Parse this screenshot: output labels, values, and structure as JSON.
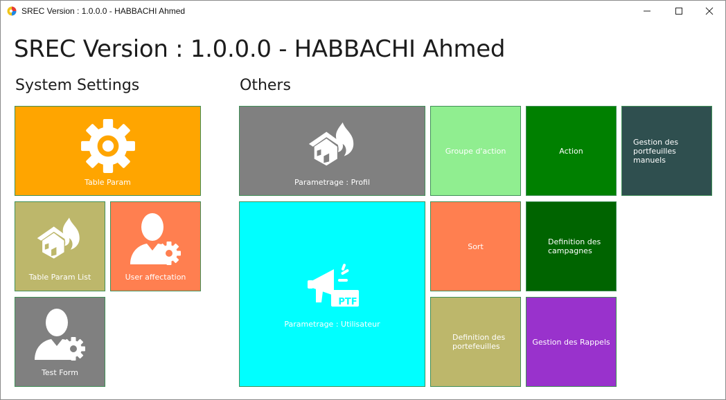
{
  "window": {
    "title": "SREC Version : 1.0.0.0 - HABBACHI Ahmed",
    "controls": {
      "minimize": "minimize-icon",
      "maximize": "maximize-icon",
      "close": "close-icon"
    }
  },
  "header": {
    "title": "SREC Version : 1.0.0.0 - HABBACHI Ahmed"
  },
  "sections": {
    "system_settings": "System Settings",
    "others": "Others"
  },
  "system_tiles": [
    {
      "label": "Table Param",
      "icon": "gear-icon",
      "color": "#FFA500"
    },
    {
      "label": "Table Param List",
      "icon": "house-fire-icon",
      "color": "#BDB76B"
    },
    {
      "label": "User affectation",
      "icon": "user-gear-icon",
      "color": "#FF7F50"
    },
    {
      "label": "Test Form",
      "icon": "user-gear-icon",
      "color": "#808080"
    }
  ],
  "other_tiles": [
    {
      "label": "Parametrage : Profil",
      "icon": "house-fire-icon",
      "color": "#808080"
    },
    {
      "label": "Parametrage : Utilisateur",
      "icon": "megaphone-ptf-icon",
      "color": "#00FFFF",
      "badge": "PTF"
    },
    {
      "label": "Groupe d'action",
      "color": "#90EE90"
    },
    {
      "label": "Action",
      "color": "#008000"
    },
    {
      "label": "Gestion des portfeuilles manuels",
      "color": "#2F4F4F"
    },
    {
      "label": "Sort",
      "color": "#FF7F50"
    },
    {
      "label": "Definition des campagnes",
      "color": "#006400"
    },
    {
      "label": "Definition des portefeuilles",
      "color": "#BDB76B"
    },
    {
      "label": "Gestion des Rappels",
      "color": "#9932CC"
    }
  ]
}
